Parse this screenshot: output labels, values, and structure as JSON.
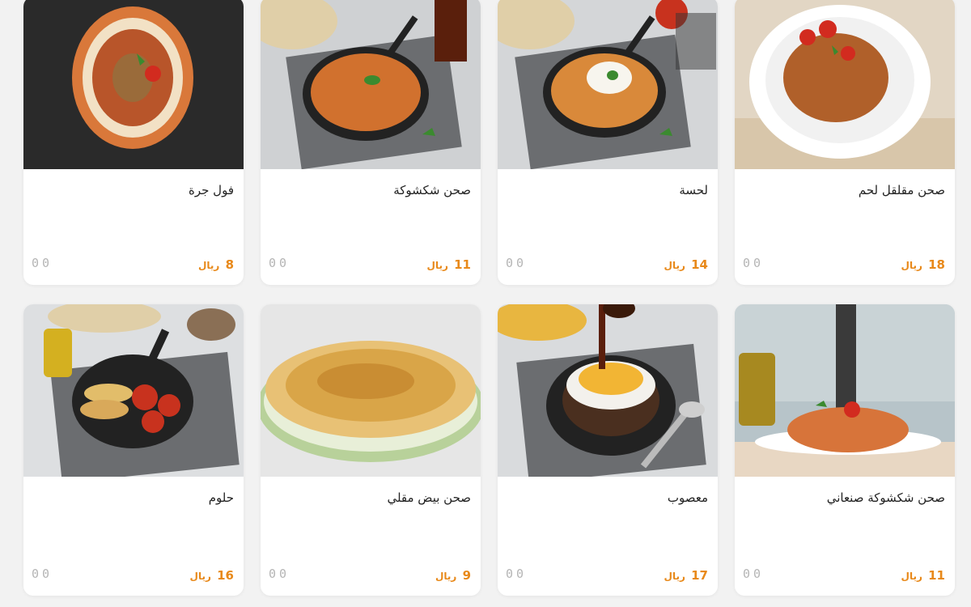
{
  "currency_label": "ريال",
  "menu_items": [
    {
      "name": "صحن مقلقل لحم",
      "price": "18",
      "qty": "00"
    },
    {
      "name": "لحسة",
      "price": "14",
      "qty": "00"
    },
    {
      "name": "صحن شكشوكة",
      "price": "11",
      "qty": "00"
    },
    {
      "name": "فول جرة",
      "price": "8",
      "qty": "00"
    },
    {
      "name": "صحن شكشوكة صنعاني",
      "price": "11",
      "qty": "00"
    },
    {
      "name": "معصوب",
      "price": "17",
      "qty": "00"
    },
    {
      "name": "صحن بيض مقلي",
      "price": "9",
      "qty": "00"
    },
    {
      "name": "حلوم",
      "price": "16",
      "qty": "00"
    }
  ]
}
